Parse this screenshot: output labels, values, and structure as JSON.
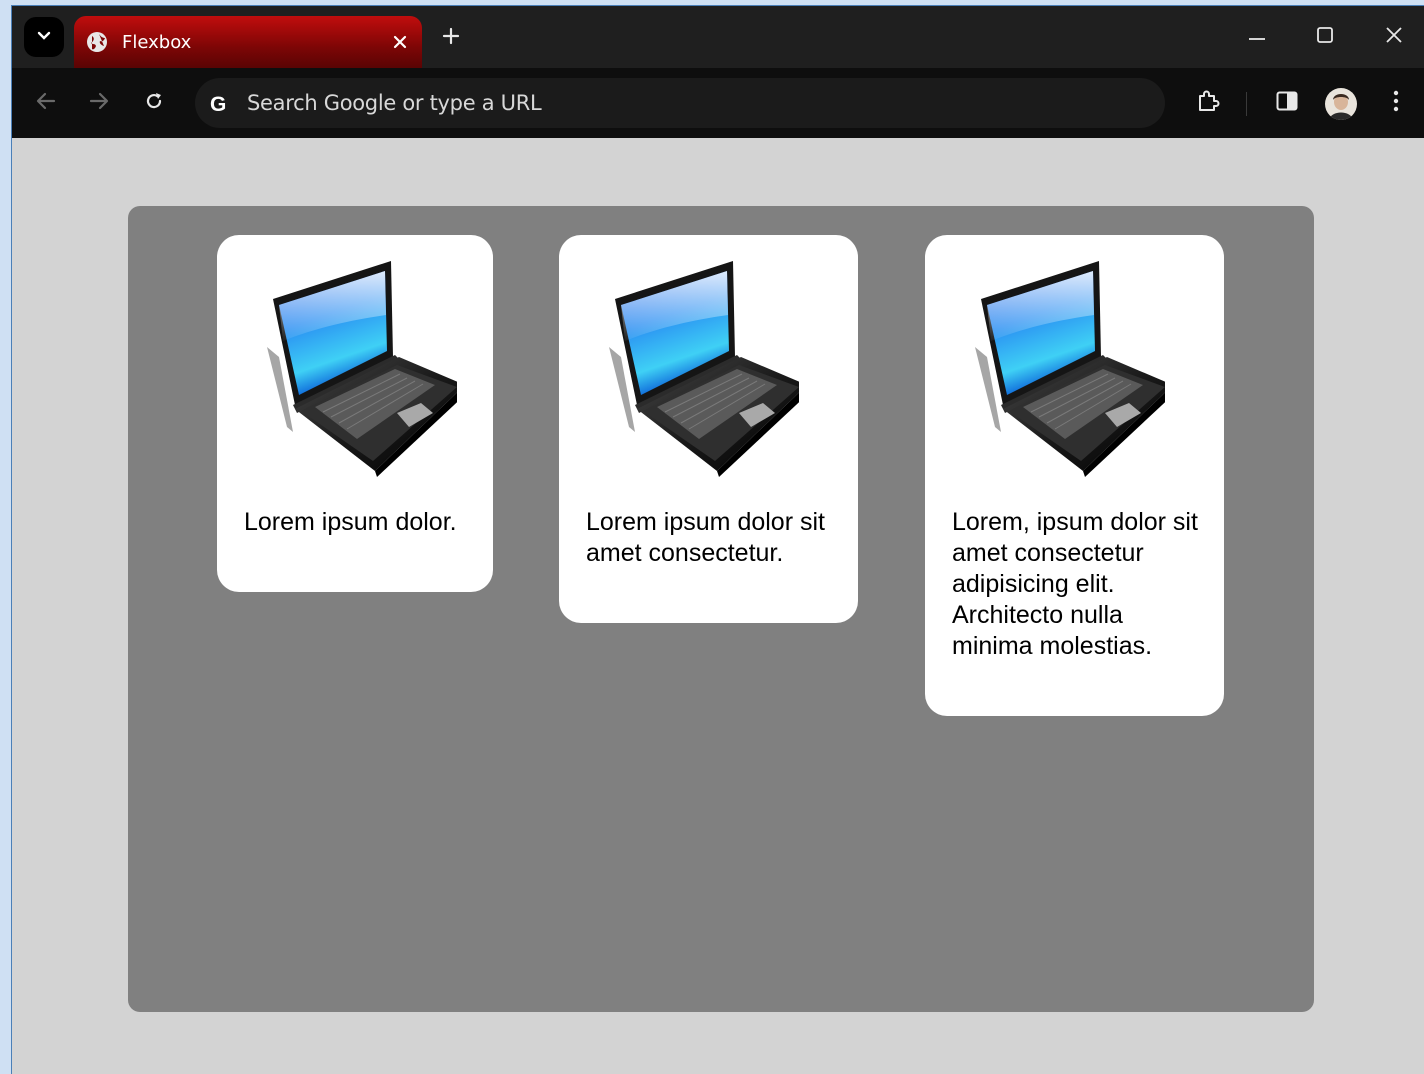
{
  "browser": {
    "tab": {
      "title": "Flexbox",
      "favicon": "globe-icon"
    },
    "omnibox": {
      "placeholder": "Search Google or type a URL"
    },
    "colors": {
      "tab_active": "#b00b0b",
      "titlebar": "#1f1f1f",
      "toolbar": "#0e0e0e"
    }
  },
  "page": {
    "background": "#d3d3d3",
    "container_color": "#808080",
    "cards": [
      {
        "image": "laptop-image",
        "text": "Lorem ipsum dolor."
      },
      {
        "image": "laptop-image",
        "text": "Lorem ipsum dolor sit amet consectetur."
      },
      {
        "image": "laptop-image",
        "text": "Lorem, ipsum dolor sit amet consectetur adipisicing elit. Architecto nulla minima molestias."
      }
    ]
  }
}
